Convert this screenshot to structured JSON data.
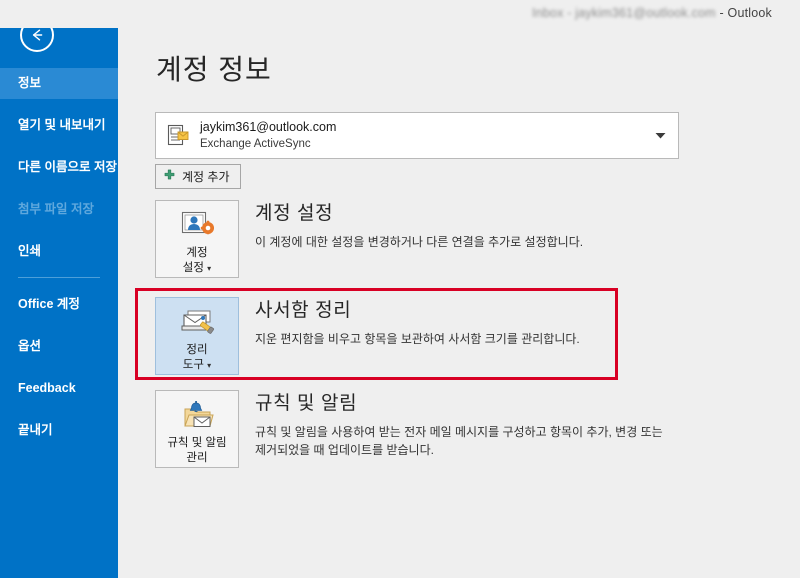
{
  "window": {
    "title_blurred": "Inbox - jaykim361@outlook.com",
    "title_app": " - Outlook"
  },
  "sidebar": {
    "back_icon": "back-arrow-icon",
    "items": [
      {
        "label": "정보",
        "state": "selected"
      },
      {
        "label": "열기 및 내보내기",
        "state": "normal"
      },
      {
        "label": "다른 이름으로 저장",
        "state": "normal"
      },
      {
        "label": "첨부 파일 저장",
        "state": "disabled"
      },
      {
        "label": "인쇄",
        "state": "normal"
      },
      {
        "label": "Office 계정",
        "state": "normal"
      },
      {
        "label": "옵션",
        "state": "normal"
      },
      {
        "label": "Feedback",
        "state": "normal"
      },
      {
        "label": "끝내기",
        "state": "normal"
      }
    ]
  },
  "main": {
    "page_title": "계정 정보",
    "account": {
      "icon": "account-mail-icon",
      "email": "jaykim361@outlook.com",
      "type": "Exchange ActiveSync",
      "caret_icon": "chevron-down-icon"
    },
    "add_account_button": {
      "label": "계정 추가",
      "icon": "plus-icon"
    },
    "sections": [
      {
        "id": "account-settings",
        "button_label_line1": "계정",
        "button_label_line2": "설정",
        "button_has_caret": true,
        "button_icon": "account-settings-icon",
        "heading": "계정 설정",
        "description": "이 계정에 대한 설정을 변경하거나 다른 연결을 추가로 설정합니다.",
        "highlighted": false
      },
      {
        "id": "mailbox-cleanup",
        "button_label_line1": "정리",
        "button_label_line2": "도구",
        "button_has_caret": true,
        "button_icon": "cleanup-tools-icon",
        "heading": "사서함 정리",
        "description": "지운 편지함을 비우고 항목을 보관하여 사서함 크기를 관리합니다.",
        "highlighted": true
      },
      {
        "id": "rules-and-alerts",
        "button_label_line1": "규칙 및 알림",
        "button_label_line2": "관리",
        "button_has_caret": false,
        "button_icon": "rules-alerts-icon",
        "heading": "규칙 및 알림",
        "description": "규칙 및 알림을 사용하여 받는 전자 메일 메시지를 구성하고 항목이 추가, 변경 또는 제거되었을 때 업데이트를 받습니다.",
        "highlighted": false
      }
    ]
  },
  "annotation": {
    "type": "red-highlight-rectangle",
    "color": "#d80024",
    "targets": "mailbox-cleanup"
  },
  "colors": {
    "sidebar_blue": "#0072c6",
    "sidebar_selected_blue": "#2a8ad4",
    "sidebar_disabled_text": "#5fa8dd",
    "content_bg": "#efefef",
    "highlight_button_bg": "#cde0f2",
    "annotation_red": "#d80024",
    "plus_green": "#2e8b57"
  }
}
